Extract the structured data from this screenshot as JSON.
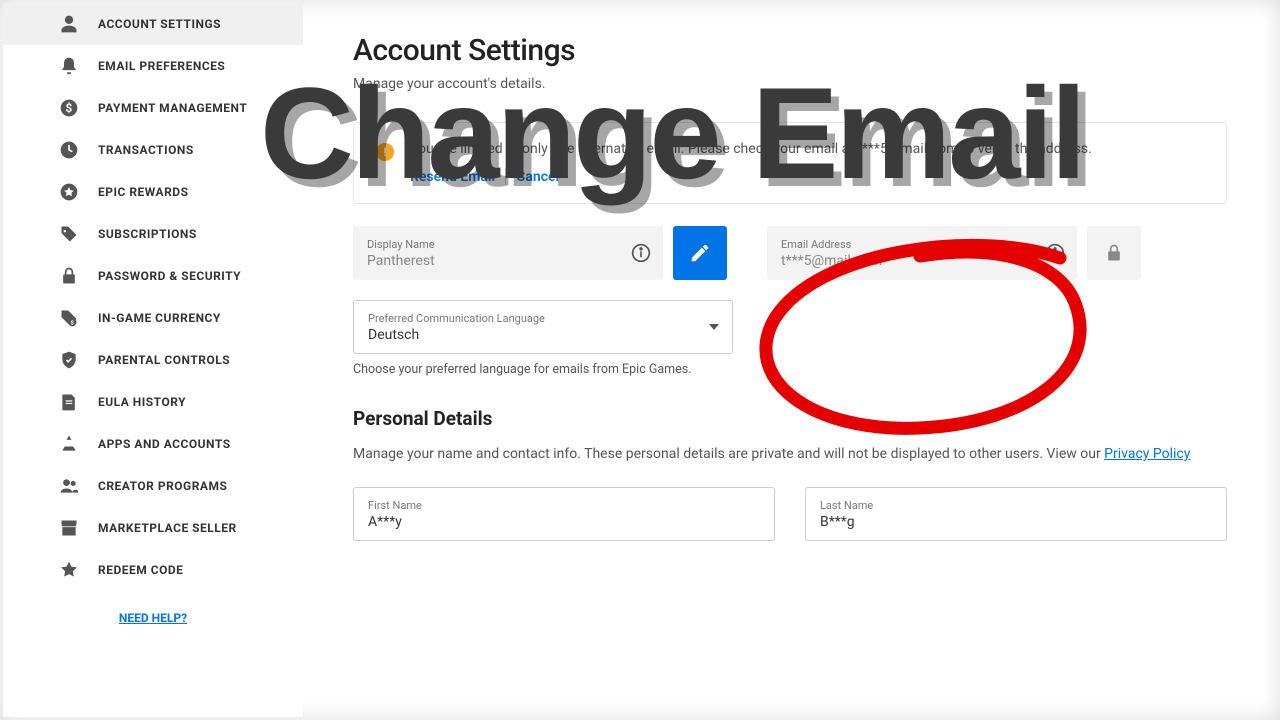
{
  "overlay": {
    "title": "Change Email"
  },
  "sidebar": {
    "items": [
      {
        "label": "ACCOUNT SETTINGS"
      },
      {
        "label": "EMAIL PREFERENCES"
      },
      {
        "label": "PAYMENT MANAGEMENT"
      },
      {
        "label": "TRANSACTIONS"
      },
      {
        "label": "EPIC REWARDS"
      },
      {
        "label": "SUBSCRIPTIONS"
      },
      {
        "label": "PASSWORD & SECURITY"
      },
      {
        "label": "IN-GAME CURRENCY"
      },
      {
        "label": "PARENTAL CONTROLS"
      },
      {
        "label": "EULA HISTORY"
      },
      {
        "label": "APPS AND ACCOUNTS"
      },
      {
        "label": "CREATOR PROGRAMS"
      },
      {
        "label": "MARKETPLACE SELLER"
      },
      {
        "label": "REDEEM CODE"
      }
    ],
    "help": "NEED HELP?"
  },
  "main": {
    "title": "Account Settings",
    "subtitle": "Manage your account's details.",
    "alert": {
      "text": "You are limited to only one alternative email. Please check your email at t***5@mail.com to verify the address.",
      "resend": "Resend Email",
      "cancel": "Cancel"
    },
    "display_name": {
      "label": "Display Name",
      "value": "Pantherest"
    },
    "email": {
      "label": "Email Address",
      "value": "t***5@mail.com"
    },
    "language": {
      "label": "Preferred Communication Language",
      "value": "Deutsch",
      "hint": "Choose your preferred language for emails from Epic Games."
    },
    "personal": {
      "heading": "Personal Details",
      "sub_prefix": "Manage your name and contact info. These personal details are private and will not be displayed to other users. View our ",
      "privacy_link": "Privacy Policy",
      "first_name": {
        "label": "First Name",
        "value": "A***y"
      },
      "last_name": {
        "label": "Last Name",
        "value": "B***g"
      }
    }
  }
}
